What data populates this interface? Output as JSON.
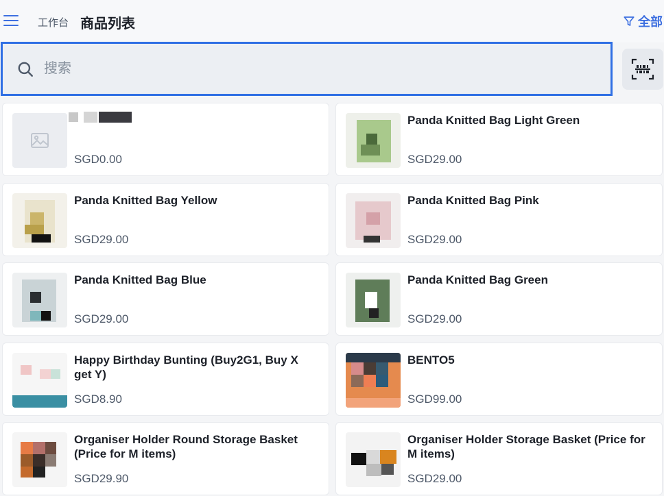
{
  "header": {
    "breadcrumb": "工作台",
    "title": "商品列表",
    "filter_label": "全部",
    "menu_icon": "hamburger-menu-icon",
    "filter_icon": "funnel-icon"
  },
  "search": {
    "placeholder": "搜索",
    "value": "",
    "icon": "search-icon",
    "scan_icon": "barcode-scan-icon"
  },
  "colors": {
    "accent": "#2f6fe4",
    "title": "#1d2129",
    "muted": "#4e5969"
  },
  "products": [
    {
      "name": "",
      "price": "SGD0.00",
      "image": "image-placeholder-icon"
    },
    {
      "name": "Panda Knitted Bag Light Green",
      "price": "SGD29.00",
      "image": "product-photo"
    },
    {
      "name": "Panda Knitted Bag Yellow",
      "price": "SGD29.00",
      "image": "product-photo"
    },
    {
      "name": "Panda Knitted Bag Pink",
      "price": "SGD29.00",
      "image": "product-photo"
    },
    {
      "name": "Panda Knitted Bag Blue",
      "price": "SGD29.00",
      "image": "product-photo"
    },
    {
      "name": "Panda Knitted Bag Green",
      "price": "SGD29.00",
      "image": "product-photo"
    },
    {
      "name": "Happy Birthday Bunting (Buy2G1, Buy X get Y)",
      "price": "SGD8.90",
      "image": "product-photo"
    },
    {
      "name": "BENTO5",
      "price": "SGD99.00",
      "image": "product-photo"
    },
    {
      "name": "Organiser Holder Round Storage Basket (Price for M items)",
      "price": "SGD29.90",
      "image": "product-photo"
    },
    {
      "name": "Organiser Holder Storage Basket (Price for M items)",
      "price": "SGD29.00",
      "image": "product-photo"
    }
  ]
}
